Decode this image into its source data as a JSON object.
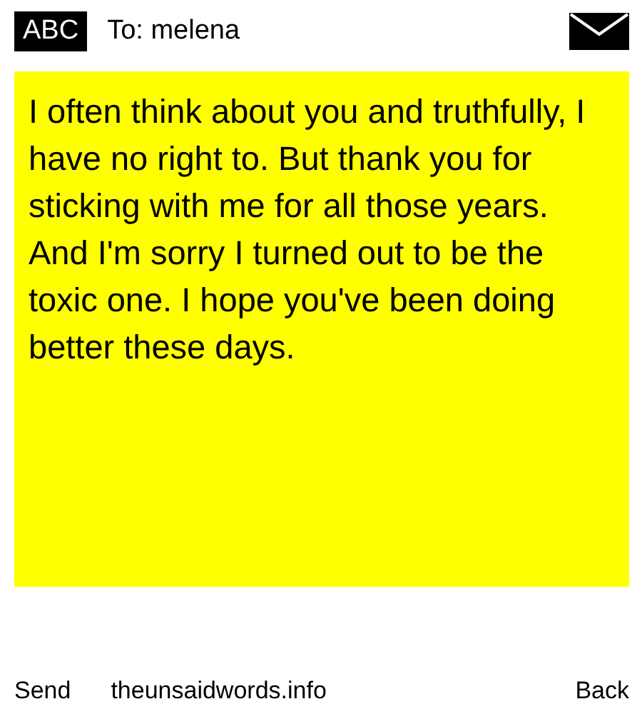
{
  "header": {
    "mode": "ABC",
    "recipient": "To: melena"
  },
  "message": {
    "text": "I often think about you and truthfully, I have no right to. But thank you for sticking with me for all those years. And I'm sorry I turned out to be the toxic one. I hope you've been doing better these days."
  },
  "softkeys": {
    "left": "Send",
    "center": "theunsaidwords.info",
    "right": "Back"
  }
}
